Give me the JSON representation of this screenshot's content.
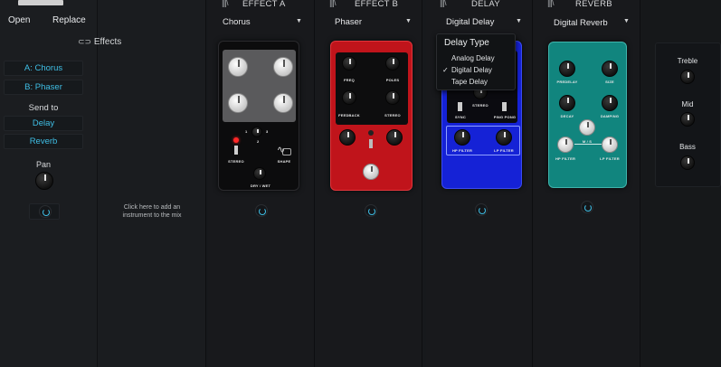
{
  "left": {
    "open_label": "Open",
    "replace_label": "Replace",
    "effects_label": "Effects",
    "chain_a": "A: Chorus",
    "chain_b": "B: Phaser",
    "send_to_label": "Send to",
    "send_delay": "Delay",
    "send_reverb": "Reverb",
    "pan_label": "Pan"
  },
  "middle": {
    "add_instrument_text": "Click here to add an instrument to the mix"
  },
  "effects": [
    {
      "header": "EFFECT A",
      "selected": "Chorus",
      "knobs": [
        "",
        "",
        "",
        ""
      ],
      "switch_label": "STEREO",
      "shape_label": "SHAPE",
      "drywet_label": "DRY / WET",
      "pos": [
        "1",
        "2",
        "3"
      ]
    },
    {
      "header": "EFFECT B",
      "selected": "Phaser",
      "labels": [
        "FREQ",
        "POLES",
        "FEEDBACK",
        "STEREO",
        "",
        ""
      ]
    },
    {
      "header": "DELAY",
      "selected": "Digital Delay",
      "labels": [
        "STEREO",
        "SYNC",
        "PING PONG",
        "HP FILTER",
        "LP FILTER"
      ]
    },
    {
      "header": "REVERB",
      "selected": "Digital Reverb",
      "labels": [
        "PREDELAY",
        "SIZE",
        "DECAY",
        "DAMPING",
        "M / S",
        "HP FILTER",
        "LP FILTER"
      ]
    }
  ],
  "delay_dropdown": {
    "title": "Delay Type",
    "options": [
      "Analog Delay",
      "Digital Delay",
      "Tape Delay"
    ],
    "selected": "Digital Delay",
    "check": "✓"
  },
  "eq": {
    "treble": "Treble",
    "mid": "Mid",
    "bass": "Bass"
  },
  "colors": {
    "accent": "#3fbfe6",
    "chorus_pedal": "#0e0e0f",
    "phaser_pedal": "#c0141b",
    "delay_pedal": "#1522d6",
    "reverb_pedal": "#11857e"
  }
}
